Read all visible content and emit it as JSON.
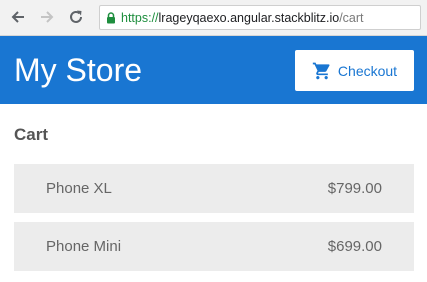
{
  "browser": {
    "url_scheme": "https://",
    "url_host": "lrageyqaexo.angular.stackblitz.io",
    "url_path": "/cart",
    "icons": {
      "back": "arrow-left-icon",
      "forward": "arrow-right-icon",
      "reload": "reload-icon",
      "secure": "lock-icon"
    }
  },
  "header": {
    "title": "My Store",
    "checkout_label": "Checkout",
    "checkout_icon": "shopping-cart-icon",
    "background_color": "#1976d2"
  },
  "cart": {
    "heading": "Cart",
    "items": [
      {
        "name": "Phone XL",
        "price": "$799.00"
      },
      {
        "name": "Phone Mini",
        "price": "$699.00"
      }
    ]
  }
}
